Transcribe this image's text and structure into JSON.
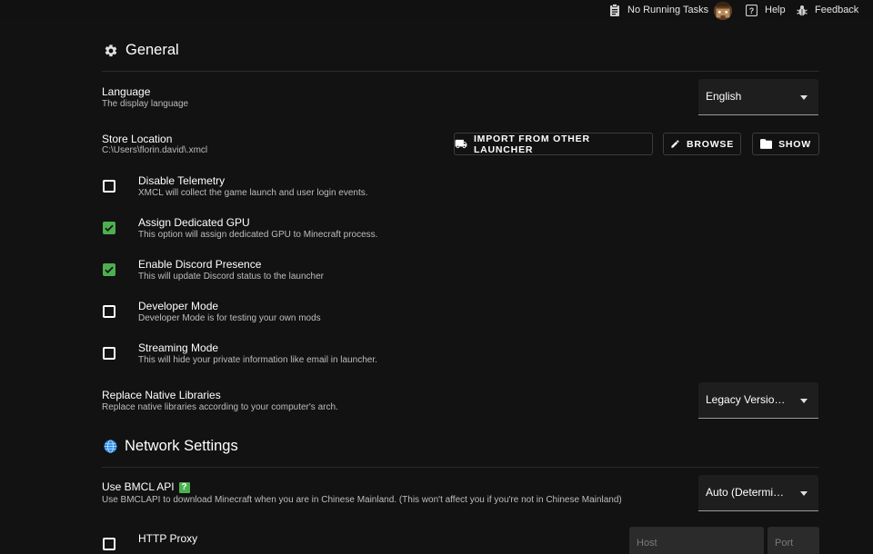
{
  "topbar": {
    "tasks_label": "No Running Tasks",
    "help_label": "Help",
    "feedback_label": "Feedback"
  },
  "general": {
    "title": "General",
    "language": {
      "title": "Language",
      "subtitle": "The display language",
      "value": "English"
    },
    "store_location": {
      "title": "Store Location",
      "path": "C:\\Users\\florin.david\\.xmcl",
      "import_label": "IMPORT FROM OTHER LAUNCHER",
      "browse_label": "BROWSE",
      "show_label": "SHOW"
    },
    "toggles": [
      {
        "title": "Disable Telemetry",
        "subtitle": "XMCL will collect the game launch and user login events.",
        "checked": false
      },
      {
        "title": "Assign Dedicated GPU",
        "subtitle": "This option will assign dedicated GPU to Minecraft process.",
        "checked": true
      },
      {
        "title": "Enable Discord Presence",
        "subtitle": "This will update Discord status to the launcher",
        "checked": true
      },
      {
        "title": "Developer Mode",
        "subtitle": "Developer Mode is for testing your own mods",
        "checked": false
      },
      {
        "title": "Streaming Mode",
        "subtitle": "This will hide your private information like email in launcher.",
        "checked": false
      }
    ],
    "replace_native": {
      "title": "Replace Native Libraries",
      "subtitle": "Replace native libraries according to your computer's arch.",
      "value": "Legacy Version Only"
    }
  },
  "network": {
    "title": "Network Settings",
    "bmcl": {
      "title": "Use BMCL API",
      "help_badge": "?",
      "subtitle": "Use BMCLAPI to download Minecraft when you are in Chinese Mainland. (This won't affect you if you're not in Chinese Mainland)",
      "value": "Auto (Determine by Network)"
    },
    "http_proxy": {
      "title": "HTTP Proxy",
      "checked": false,
      "host_placeholder": "Host",
      "port_placeholder": "Port"
    }
  },
  "colors": {
    "background": "#121212",
    "accent_green": "#4caf50",
    "select_bg": "#1e1e1e"
  }
}
